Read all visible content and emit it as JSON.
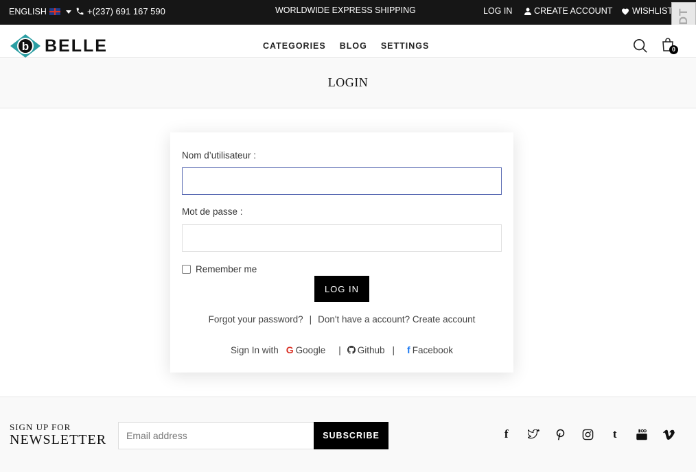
{
  "topbar": {
    "language": "ENGLISH",
    "phone": "+(237) 691 167 590",
    "shipping": "WORLDWIDE EXPRESS SHIPPING",
    "login": "LOG IN",
    "create_account": "CREATE ACCOUNT",
    "wishlist": "WISHLIST",
    "badge": "DJDT"
  },
  "header": {
    "logo": "BELLE",
    "nav": [
      "CATEGORIES",
      "BLOG",
      "SETTINGS"
    ],
    "cart_count": "0"
  },
  "page": {
    "title": "LOGIN"
  },
  "form": {
    "username_label": "Nom d’utilisateur :",
    "username_value": "",
    "password_label": "Mot de passe :",
    "password_value": "",
    "remember_label": "Remember me",
    "remember_checked": false,
    "submit_label": "LOG IN",
    "forgot_password": "Forgot your password?",
    "separator": "|",
    "no_account": "Don't have a account? Create account",
    "sign_in_with": "Sign In with",
    "google": "Google",
    "github": "Github",
    "facebook": "Facebook"
  },
  "footer": {
    "signup_small": "SIGN UP FOR",
    "signup_big": "NEWSLETTER",
    "email_placeholder": "Email address",
    "subscribe": "SUBSCRIBE",
    "social_icons": [
      "facebook-icon",
      "twitter-icon",
      "pinterest-icon",
      "instagram-icon",
      "tumblr-icon",
      "youtube-icon",
      "vimeo-icon"
    ]
  },
  "colors": {
    "topbar_bg": "#161616",
    "accent_teal": "#2a9ea3",
    "button_bg": "#000000",
    "focus_border": "#5a6bb3",
    "google_red": "#d93025",
    "facebook_blue": "#1877f2"
  }
}
